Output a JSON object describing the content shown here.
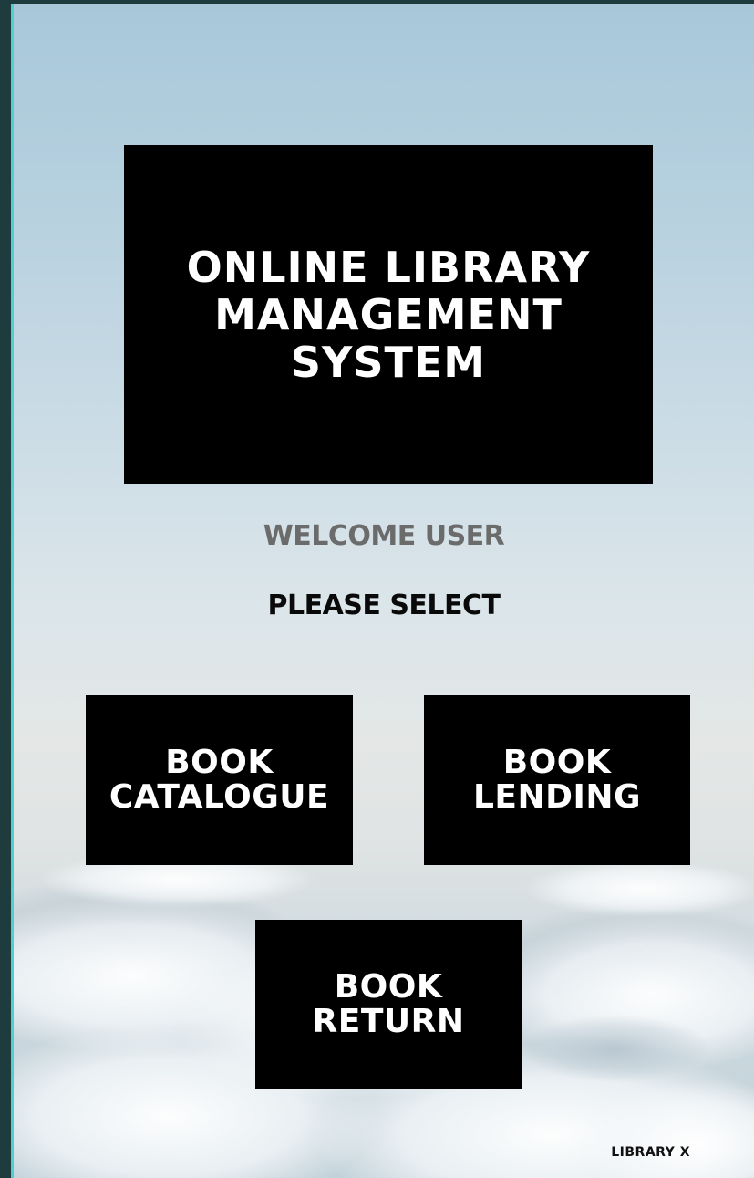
{
  "title": {
    "line1": "ONLINE LIBRARY",
    "line2": "MANAGEMENT",
    "line3": "SYSTEM"
  },
  "welcome_text": "WELCOME USER",
  "prompt_text": "PLEASE SELECT",
  "buttons": {
    "catalogue": {
      "line1": "BOOK",
      "line2": "CATALOGUE"
    },
    "lending": {
      "line1": "BOOK",
      "line2": "LENDING"
    },
    "return": {
      "line1": "BOOK",
      "line2": "RETURN"
    }
  },
  "footer_text": "LIBRARY X",
  "colors": {
    "box_background": "#000000",
    "box_text": "#ffffff",
    "welcome_text": "#6b6b6b",
    "frame_accent": "#4fd0cf"
  }
}
